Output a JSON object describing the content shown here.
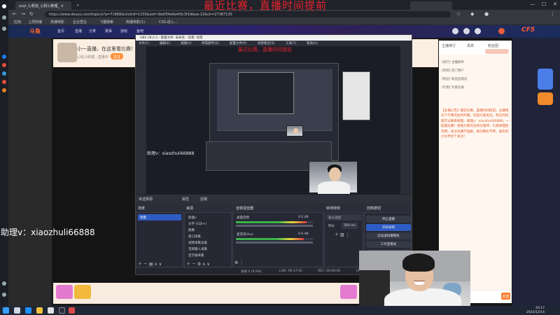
{
  "overlay_title": "最近比赛，直播时间提前",
  "overlay_subtitle": "最近比赛，直播时间提前",
  "assistant_text": "助理v：xiaozhuli66888",
  "obs_wechat_text": "助理v：xiaozhuli66888",
  "browser": {
    "tabs": [
      {
        "label": "yuyi_心机包_心机小助理_ ×",
        "active": true
      },
      {
        "label": "+",
        "active": false
      }
    ],
    "url": "https://www.douyu.com/topic/s?a=71868&clickid=1235&sid=3bdf34e8a4f3c3f19&oa-22&ch=27387135",
    "bookmarks": [
      "应用",
      "上周热播",
      "热播电影",
      "企业营业",
      "飞猫搜索",
      "热播电影(1)",
      "CSS-进入..."
    ],
    "window_min": "—",
    "window_max": "☐",
    "window_close": "✕"
  },
  "site_header": {
    "logo": "斗鱼",
    "nav": [
      "首页",
      "直播",
      "分类",
      "赛事",
      "游戏",
      "鱼吧"
    ],
    "right_logo": "CF5"
  },
  "banner": {
    "title": "小一直播，在这里看比赛！",
    "sub": "心机小助理 · 直播中",
    "tag": "关注"
  },
  "obs": {
    "title": "OBS 28.0.3 - 配置文件: 未命名 - 场景: 场景",
    "menu": [
      "文件(F)",
      "编辑(E)",
      "视图(V)",
      "停靠部件(D)",
      "配置文件(P)",
      "场景集合(S)",
      "工具(T)",
      "帮助(H)"
    ],
    "toolbar": [
      "未选择源",
      "属性",
      "滤镜"
    ],
    "dock_titles": {
      "scenes": "场景",
      "sources": "来源",
      "mixer": "音频混音器",
      "transitions": "转场特效",
      "controls": "控制按钮"
    },
    "scenes": [
      "场景"
    ],
    "sources": [
      "助理v",
      "文字 (GDI+)",
      "图像",
      "窗口采集",
      "视频采集设备",
      "音频输入采集",
      "显示器采集"
    ],
    "mixer": [
      {
        "name": "桌面音频",
        "db": "0.0 dB",
        "level": 0.92
      },
      {
        "name": "麦克风/Aux",
        "db": "0.0 dB",
        "level": 0.88
      }
    ],
    "transition": {
      "label": "淡入淡出",
      "duration_label": "时长",
      "duration": "300 ms"
    },
    "controls": [
      "停止直播",
      "开始录制",
      "启动虚拟摄像机",
      "工作室模式",
      "设置",
      "退出"
    ],
    "status": [
      "丢帧 0 (0.0%)",
      "LIVE: 00:17:42",
      "REC: 00:00:00",
      "CPU: 3.1%, 60.00 fps"
    ]
  },
  "chat": {
    "tabs": [
      "主播排行",
      "贵宾",
      "粉丝团"
    ],
    "lines": [
      "[排行] 主播榜单",
      "[贵宾] 热门用户",
      "[粉丝] 粉丝团成员",
      "[礼物] 礼物记录"
    ],
    "body": "【主播公告】最近比赛，直播时间提前。主播每天下午两点准时开播，欢迎大家关注，有任何问题可以联系助理，助理v：xiaozhuli66888，一起看比赛！感谢大家的支持与陪伴，礼物请理性消费。关注主播不迷路，每天精彩不断，喜欢的小伙伴点个关注！",
    "input_placeholder": "",
    "send": "发送"
  },
  "taskbar": {
    "time": "20:17",
    "date": "2023/12/14"
  },
  "colors": {
    "overlay_red": "#e8232f",
    "obs_bg": "#2b2e38",
    "obs_select": "#2f5cc4",
    "chat_text": "#e25a2c"
  }
}
